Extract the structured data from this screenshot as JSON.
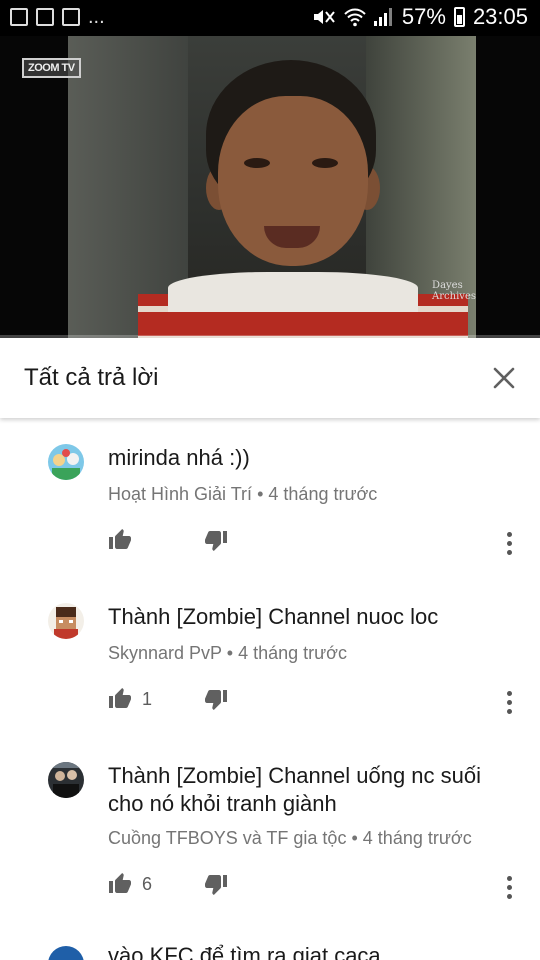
{
  "status_bar": {
    "battery_percent": "57%",
    "time": "23:05",
    "left_icons": [
      "image-icon",
      "wattpad-icon",
      "document-icon"
    ],
    "overflow": "..."
  },
  "video": {
    "watermark_top": "ZOOM TV",
    "watermark_bottom_line1": "Dayes",
    "watermark_bottom_line2": "Archives",
    "progress": 0.0
  },
  "replies_header": {
    "title": "Tất cả trả lời",
    "close_icon": "close-icon"
  },
  "comments": [
    {
      "text": "mirinda nhá :))",
      "author": "Hoạt Hình Giải Trí",
      "time": "4 tháng trước",
      "likes": ""
    },
    {
      "text": "Thành [Zombie] Channel nuoc loc",
      "author": "Skynnard PvP",
      "time": "4 tháng trước",
      "likes": "1"
    },
    {
      "text": "Thành [Zombie] Channel uống nc suối cho nó khỏi tranh giành",
      "author": "Cuồng TFBOYS và TF gia tộc",
      "time": "4 tháng trước",
      "likes": "6"
    },
    {
      "text": "vào KFC để tìm ra giạt caca",
      "author": "",
      "time": "",
      "likes": ""
    }
  ],
  "separator": "•",
  "colors": {
    "progress_red": "#e62117",
    "meta_gray": "#757575"
  }
}
